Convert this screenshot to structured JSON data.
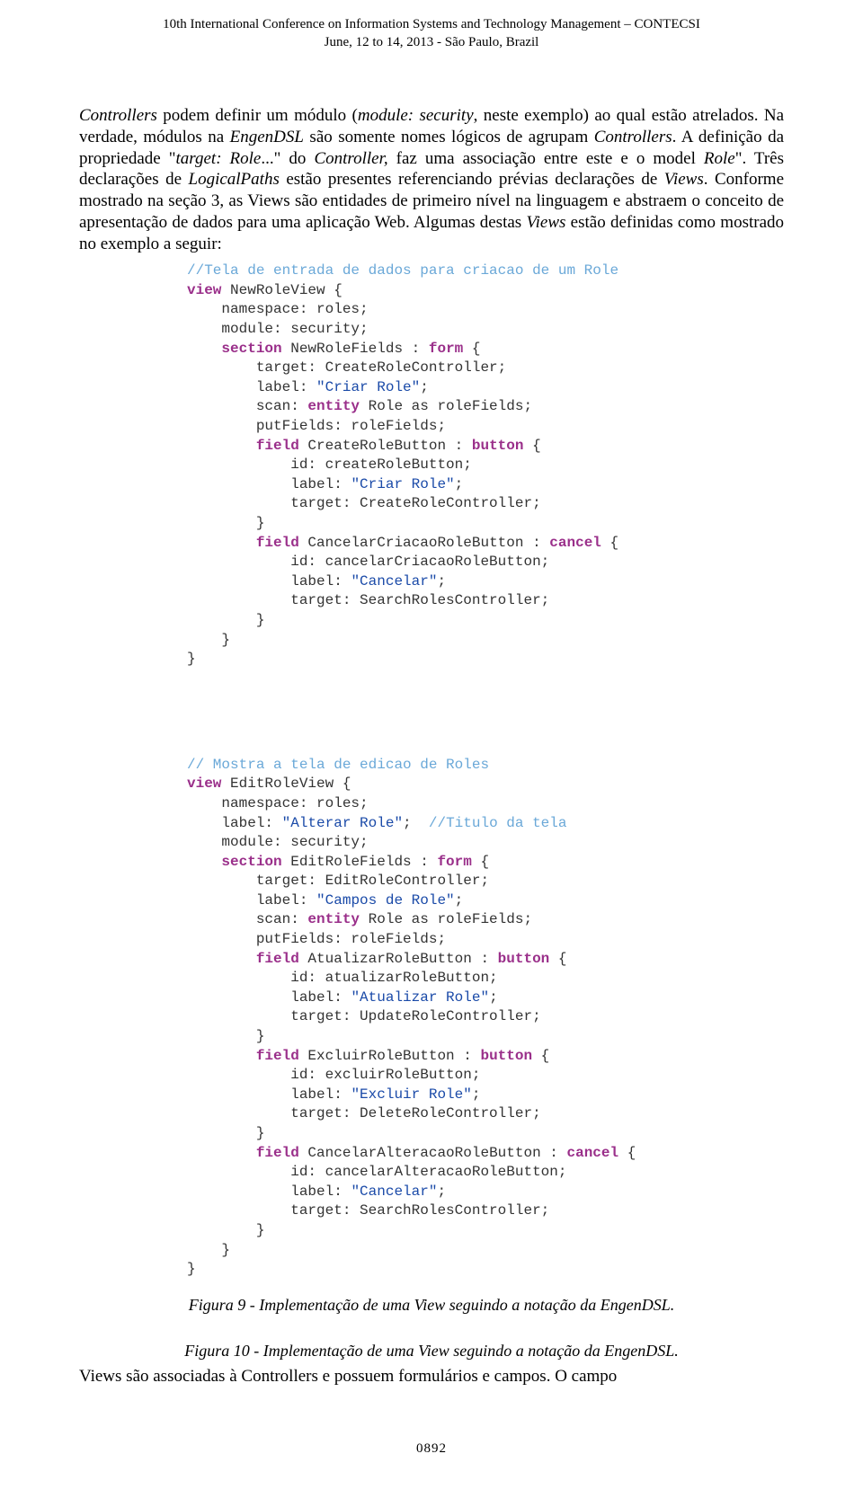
{
  "header": {
    "line1": "10th International Conference on Information Systems and Technology Management – CONTECSI",
    "line2": "June, 12 to 14, 2013 - São Paulo, Brazil"
  },
  "para1": {
    "t1": "Controllers",
    "t2": " podem definir um módulo (",
    "t3": "module: security",
    "t4": ", neste exemplo) ao qual estão atrelados. Na verdade, módulos na ",
    "t5": "EngenDSL",
    "t6": " são somente nomes lógicos de agrupam ",
    "t7": "Controllers",
    "t8": ". A definição da propriedade \"",
    "t9": "target: Role",
    "t10": "...\" do ",
    "t11": "Controller,",
    "t12": " faz uma associação entre este e o model ",
    "t13": "Role",
    "t14": "\". Três declarações de ",
    "t15": "LogicalPaths",
    "t16": " estão presentes referenciando prévias declarações de ",
    "t17": "Views",
    "t18": ". Conforme mostrado na seção 3, as Views são entidades de primeiro nível na linguagem e abstraem o conceito de apresentação de dados para uma aplicação Web. Algumas destas ",
    "t19": "Views",
    "t20": " estão definidas como mostrado no exemplo a seguir:"
  },
  "code1": {
    "c0": "//Tela de entrada de dados para criacao de um Role",
    "l1a": "view",
    "l1b": " NewRoleView {",
    "l2": "    namespace: roles;",
    "l3": "    module: security;",
    "l4a": "    section",
    "l4b": " NewRoleFields : ",
    "l4c": "form",
    "l4d": " {",
    "l5": "        target: CreateRoleController;",
    "l6a": "        label: ",
    "l6b": "\"Criar Role\"",
    "l6c": ";",
    "l7a": "        scan: ",
    "l7b": "entity",
    "l7c": " Role as roleFields;",
    "l8": "        putFields: roleFields;",
    "l9a": "        field",
    "l9b": " CreateRoleButton : ",
    "l9c": "button",
    "l9d": " {",
    "l10": "            id: createRoleButton;",
    "l11a": "            label: ",
    "l11b": "\"Criar Role\"",
    "l11c": ";",
    "l12": "            target: CreateRoleController;",
    "l13": "        }",
    "l14a": "        field",
    "l14b": " CancelarCriacaoRoleButton : ",
    "l14c": "cancel",
    "l14d": " {",
    "l15": "            id: cancelarCriacaoRoleButton;",
    "l16a": "            label: ",
    "l16b": "\"Cancelar\"",
    "l16c": ";",
    "l17": "            target: SearchRolesController;",
    "l18": "        }",
    "l19": "    }",
    "l20": "}"
  },
  "code2": {
    "c0": "// Mostra a tela de edicao de Roles",
    "l1a": "view",
    "l1b": " EditRoleView {",
    "l2": "    namespace: roles;",
    "l3a": "    label: ",
    "l3b": "\"Alterar Role\"",
    "l3c": ";  ",
    "l3d": "//Titulo da tela",
    "l4": "    module: security;",
    "l5a": "    section",
    "l5b": " EditRoleFields : ",
    "l5c": "form",
    "l5d": " {",
    "l6": "        target: EditRoleController;",
    "l7a": "        label: ",
    "l7b": "\"Campos de Role\"",
    "l7c": ";",
    "l8a": "        scan: ",
    "l8b": "entity",
    "l8c": " Role as roleFields;",
    "l9": "        putFields: roleFields;",
    "l10a": "        field",
    "l10b": " AtualizarRoleButton : ",
    "l10c": "button",
    "l10d": " {",
    "l11": "            id: atualizarRoleButton;",
    "l12a": "            label: ",
    "l12b": "\"Atualizar Role\"",
    "l12c": ";",
    "l13": "            target: UpdateRoleController;",
    "l14": "        }",
    "l15a": "        field",
    "l15b": " ExcluirRoleButton : ",
    "l15c": "button",
    "l15d": " {",
    "l16": "            id: excluirRoleButton;",
    "l17a": "            label: ",
    "l17b": "\"Excluir Role\"",
    "l17c": ";",
    "l18": "            target: DeleteRoleController;",
    "l19": "        }",
    "l20a": "        field",
    "l20b": " CancelarAlteracaoRoleButton : ",
    "l20c": "cancel",
    "l20d": " {",
    "l21": "            id: cancelarAlteracaoRoleButton;",
    "l22a": "            label: ",
    "l22b": "\"Cancelar\"",
    "l22c": ";",
    "l23": "            target: SearchRolesController;",
    "l24": "        }",
    "l25": "    }",
    "l26": "}"
  },
  "caption1": "Figura 9 - Implementação de uma View seguindo a notação da EngenDSL.",
  "caption2": "Figura 10 - Implementação de uma View seguindo a notação da EngenDSL.",
  "para2": {
    "t1": "Views",
    "t2": "  são  associadas  à  ",
    "t3": "Controllers",
    "t4": "  e  possuem  formulários  e  campos.  O  campo"
  },
  "page_number": "0892"
}
